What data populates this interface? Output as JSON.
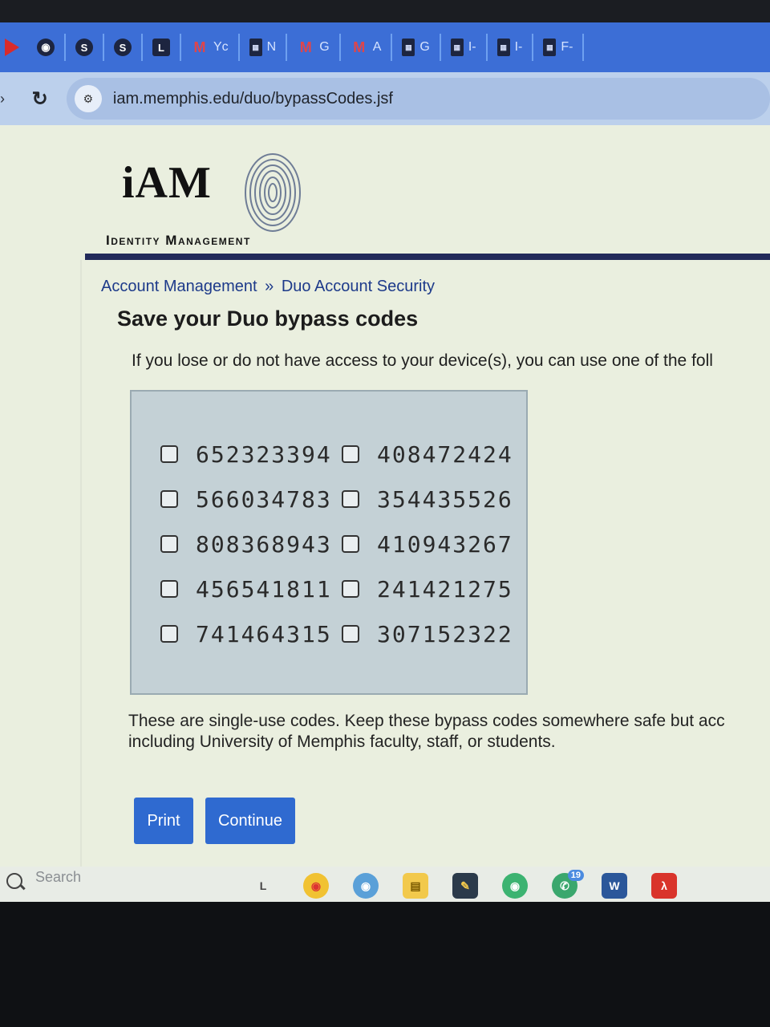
{
  "browser": {
    "tabs": [
      {
        "icon": "github-icon",
        "label": ""
      },
      {
        "icon": "ssb-icon",
        "label": ""
      },
      {
        "icon": "ssb-icon",
        "label": ""
      },
      {
        "icon": "l-app-icon",
        "label": ""
      },
      {
        "icon": "gmail-icon",
        "label": "Yc"
      },
      {
        "icon": "document-icon",
        "label": "N"
      },
      {
        "icon": "gmail-icon",
        "label": "G"
      },
      {
        "icon": "gmail-icon",
        "label": "A"
      },
      {
        "icon": "document-icon",
        "label": "G"
      },
      {
        "icon": "document-icon",
        "label": "I-"
      },
      {
        "icon": "document-icon",
        "label": "I-"
      },
      {
        "icon": "document-icon",
        "label": "F-"
      }
    ],
    "url": "iam.memphis.edu/duo/bypassCodes.jsf"
  },
  "logo": {
    "title": "iAM",
    "subtitle": "Identity Management"
  },
  "breadcrumb": {
    "parent": "Account Management",
    "separator": "»",
    "current": "Duo Account Security"
  },
  "heading": "Save your Duo bypass codes",
  "intro": "If you lose or do not have access to your device(s), you can use one of the foll",
  "codes": [
    [
      "652323394",
      "408472424"
    ],
    [
      "566034783",
      "354435526"
    ],
    [
      "808368943",
      "410943267"
    ],
    [
      "456541811",
      "241421275"
    ],
    [
      "741464315",
      "307152322"
    ]
  ],
  "footnote": {
    "line1": "These are single-use codes. Keep these bypass codes somewhere safe but acc",
    "line2": "including University of Memphis faculty, staff, or students."
  },
  "buttons": {
    "print": "Print",
    "continue": "Continue"
  },
  "taskbar": {
    "search_label": "Search",
    "whatsapp_badge": "19"
  },
  "colors": {
    "accent": "#2f6ad0",
    "header_rule": "#222a5a",
    "codes_bg": "#c4d1d6"
  }
}
